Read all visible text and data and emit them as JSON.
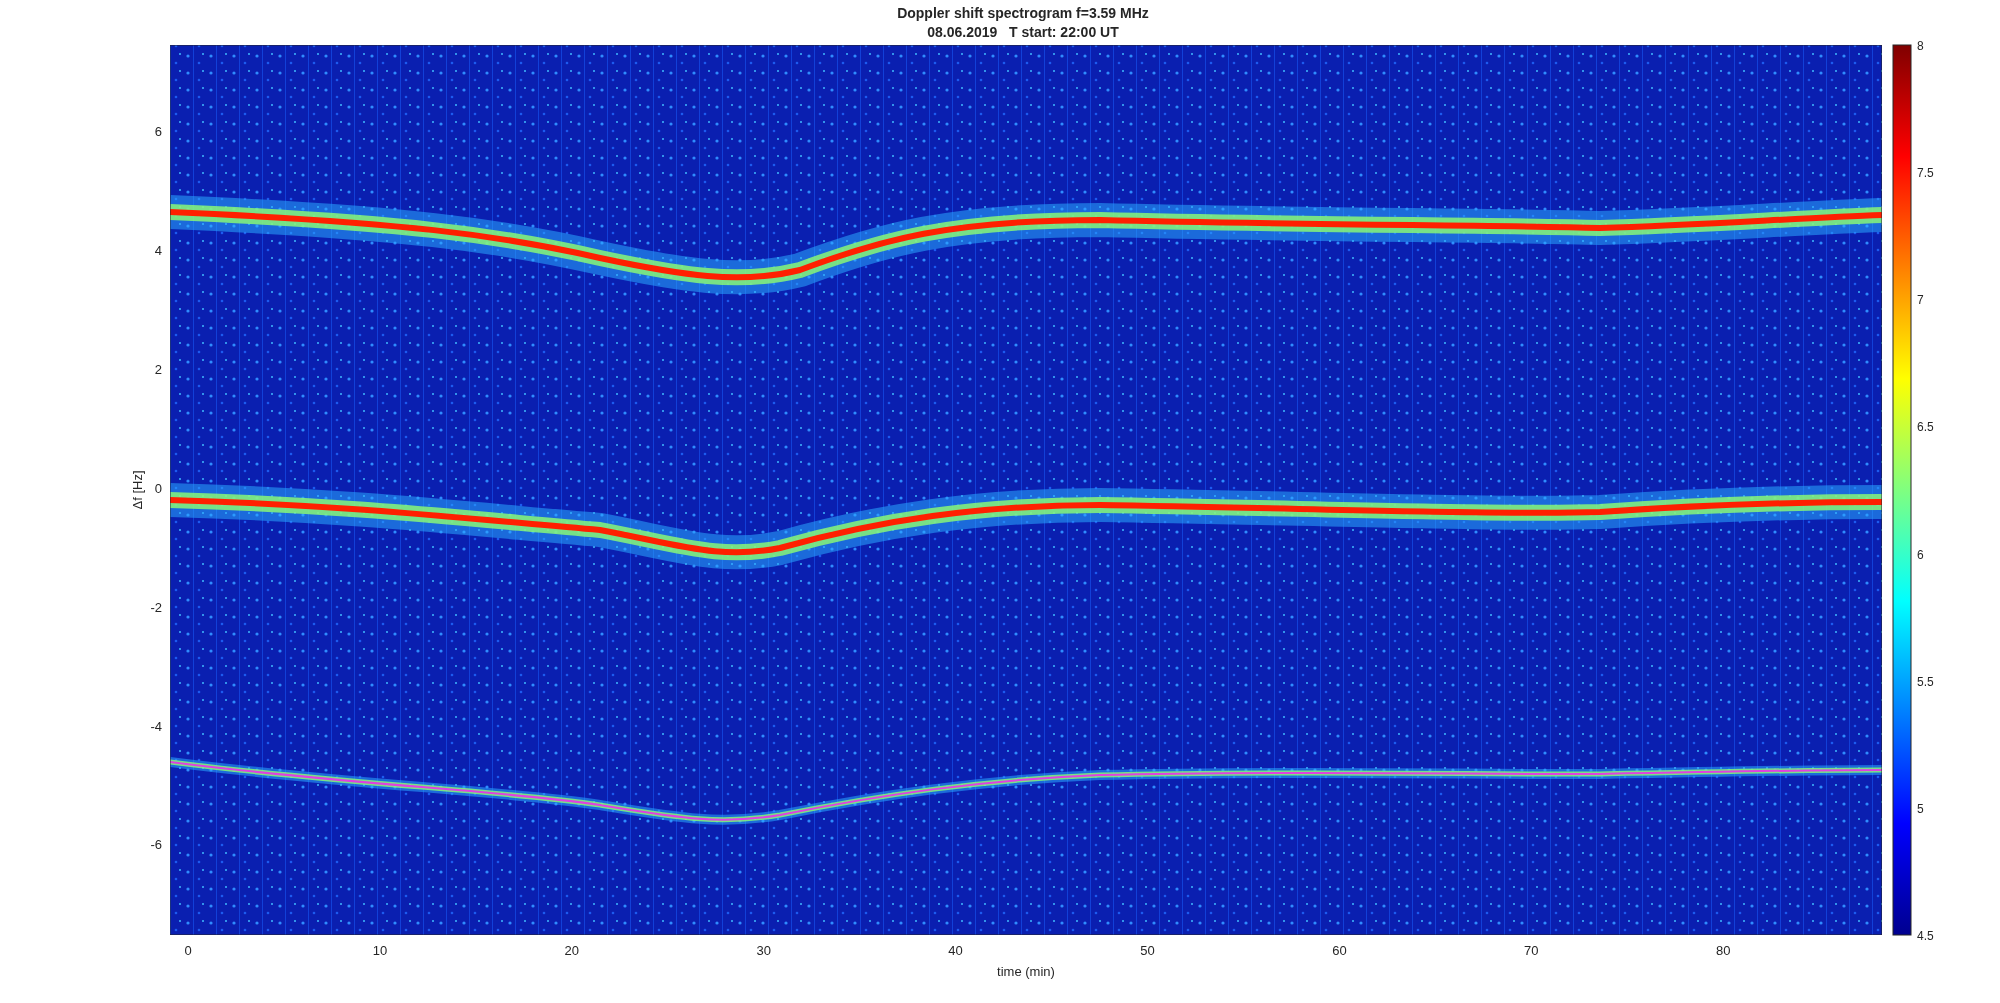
{
  "title": {
    "line1": "Doppler shift spectrogram f=3.59 MHz",
    "line2": "08.06.2019   T start: 22:00 UT"
  },
  "axes": {
    "xlabel": "time (min)",
    "ylabel": "Δf [Hz]",
    "xticks": [
      "0",
      "10",
      "20",
      "30",
      "40",
      "50",
      "60",
      "70",
      "80"
    ],
    "yticks": [
      "6",
      "4",
      "2",
      "0",
      "-2",
      "-4",
      "-6"
    ]
  },
  "colorbar": {
    "ticks": [
      "8",
      "7.5",
      "7",
      "6.5",
      "6",
      "5.5",
      "5",
      "4.5"
    ]
  }
}
